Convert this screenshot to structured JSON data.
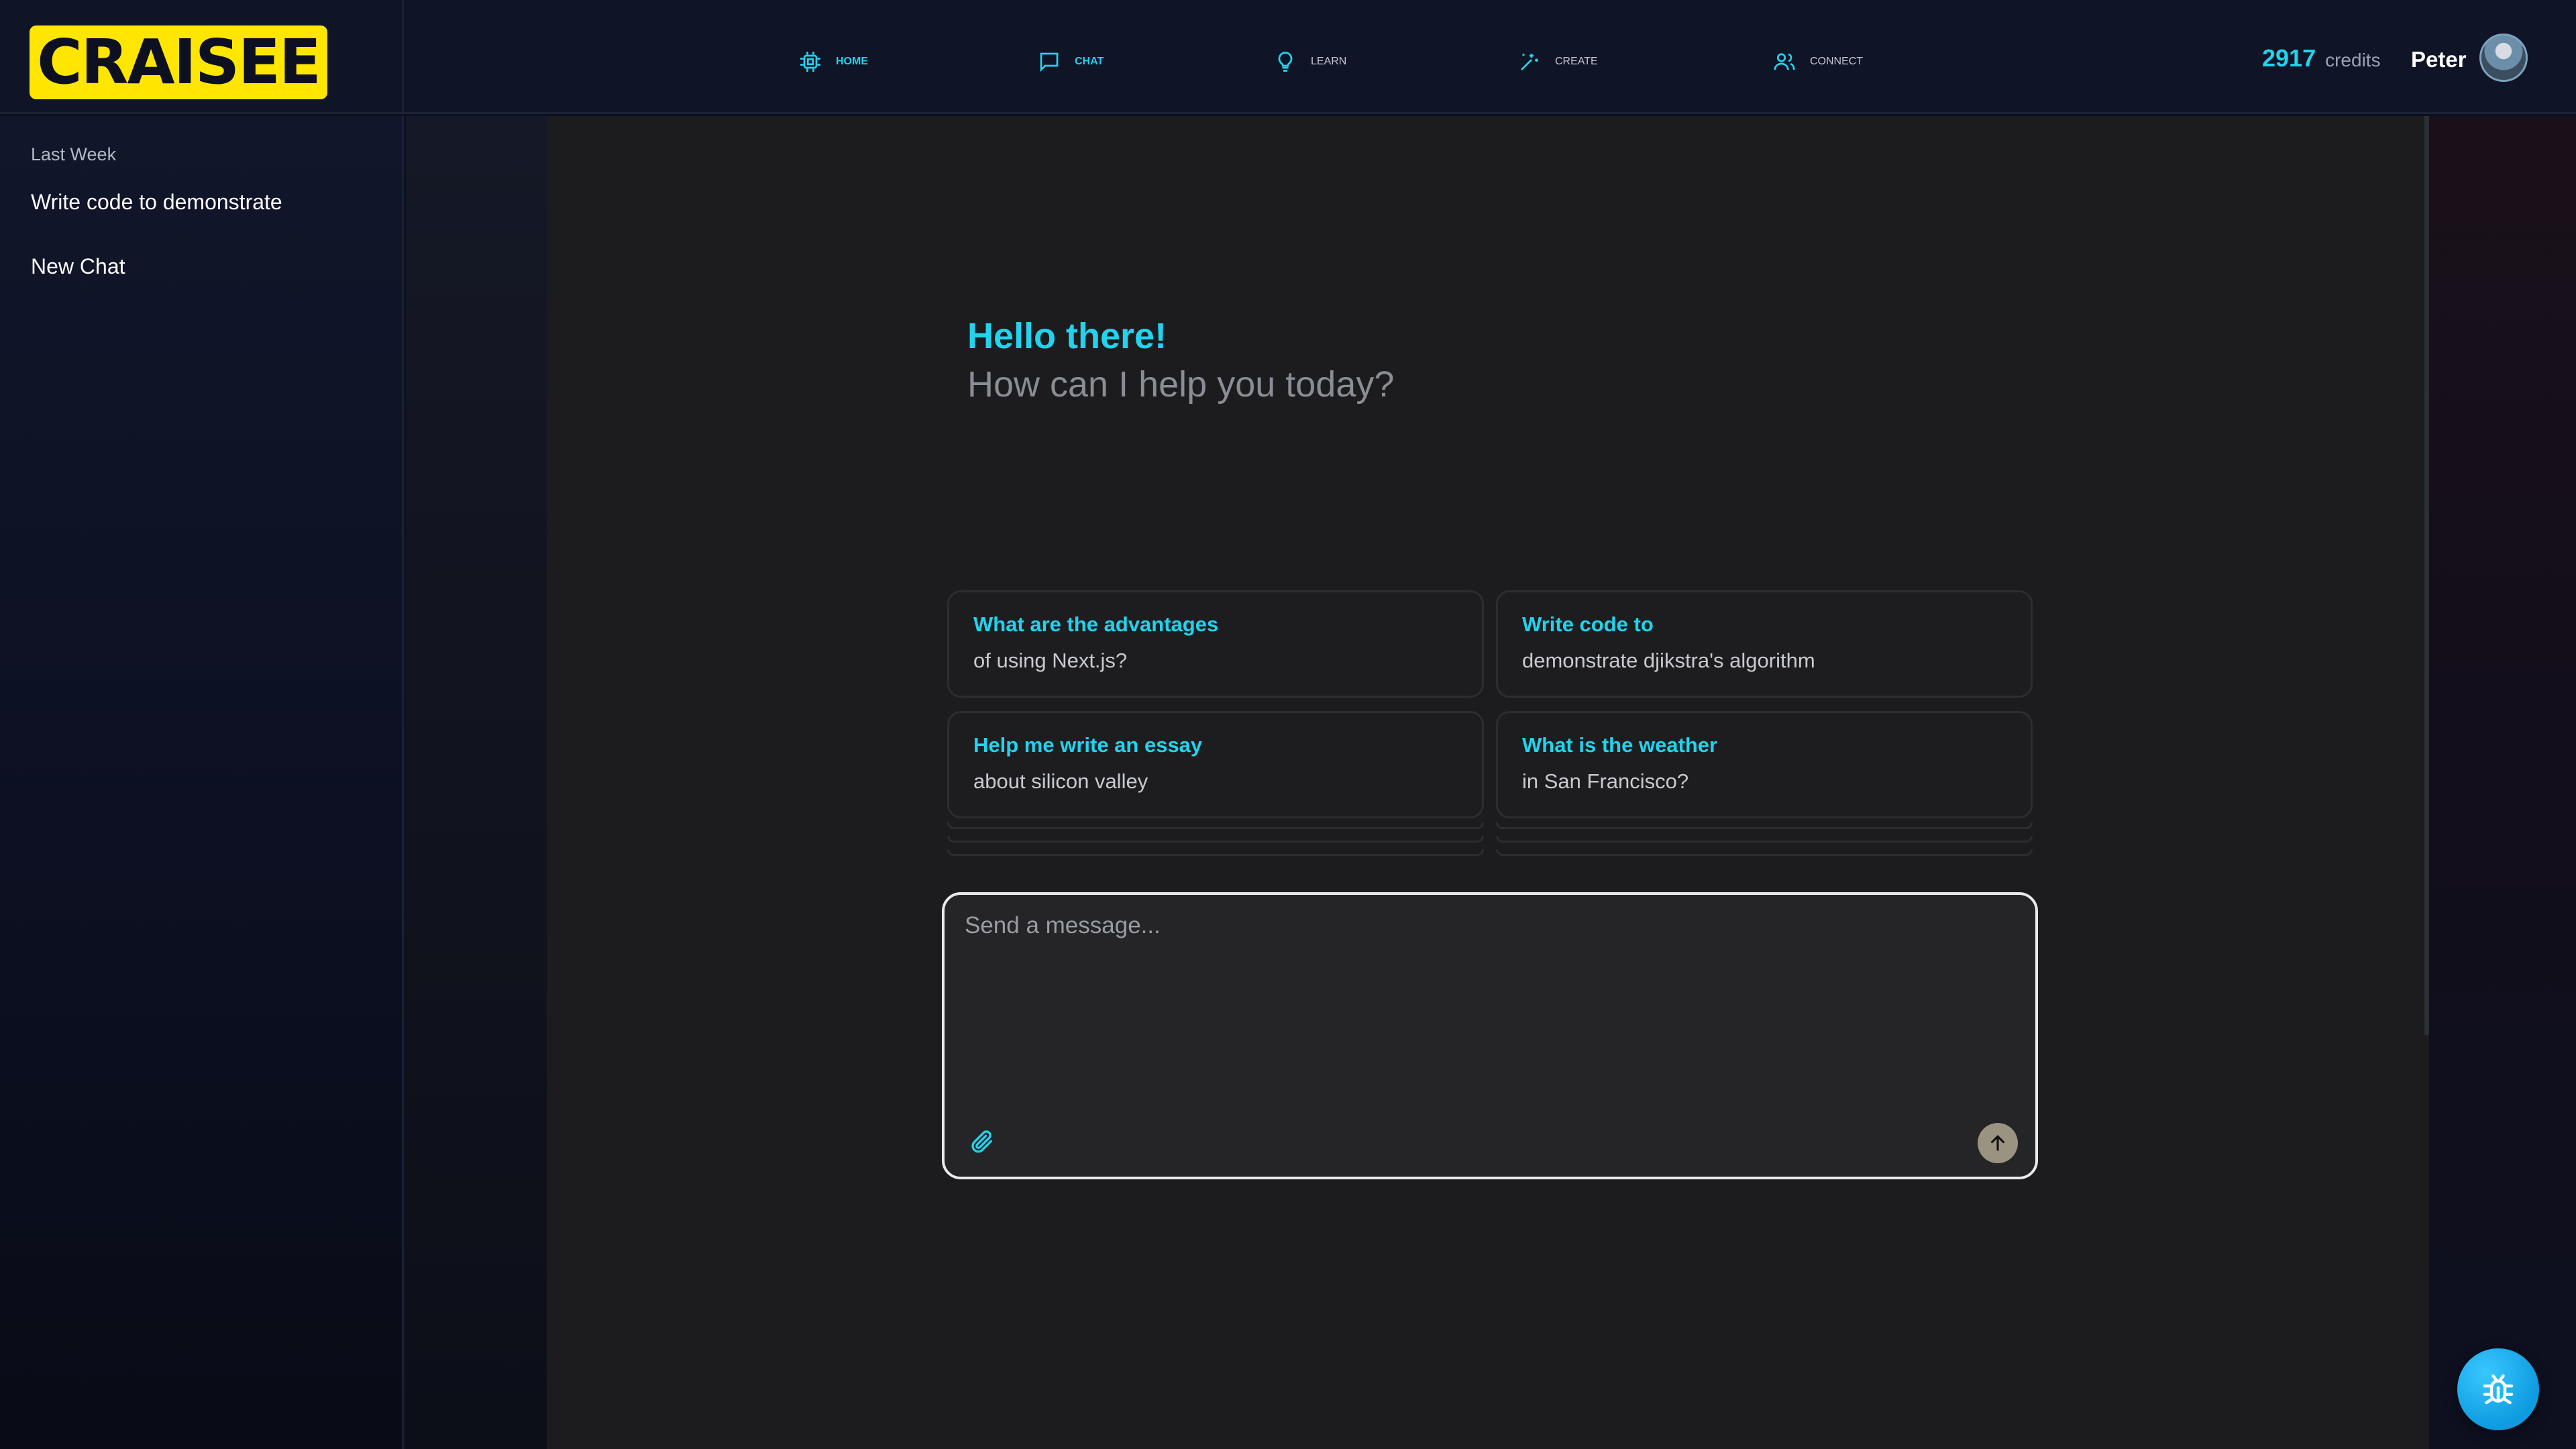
{
  "brand": {
    "logo_text": "CRAISEE",
    "logo_color": "#ffe600"
  },
  "nav": {
    "items": [
      {
        "label": "HOME",
        "icon": "cpu-icon",
        "active": true
      },
      {
        "label": "CHAT",
        "icon": "chat-bubble-icon",
        "active": false
      },
      {
        "label": "LEARN",
        "icon": "lightbulb-icon",
        "active": false
      },
      {
        "label": "CREATE",
        "icon": "sparkle-wand-icon",
        "active": false
      },
      {
        "label": "CONNECT",
        "icon": "users-icon",
        "active": false
      }
    ]
  },
  "account": {
    "credits_value": "2917",
    "credits_label": "credits",
    "user_name": "Peter"
  },
  "sidebar": {
    "section_label": "Last Week",
    "items": [
      {
        "label": "Write code to demonstrate"
      },
      {
        "label": "New Chat"
      }
    ]
  },
  "greeting": {
    "title": "Hello there!",
    "subtitle": "How can I help you today?"
  },
  "suggestions": [
    {
      "title": "What are the advantages",
      "subtitle": "of using Next.js?"
    },
    {
      "title": "Write code to",
      "subtitle": "demonstrate djikstra's algorithm"
    },
    {
      "title": "Help me write an essay",
      "subtitle": "about silicon valley"
    },
    {
      "title": "What is the weather",
      "subtitle": "in San Francisco?"
    }
  ],
  "composer": {
    "placeholder": "Send a message...",
    "value": ""
  },
  "colors": {
    "accent": "#22d3ee",
    "background": "#1c1c1e",
    "header": "#0f1426"
  }
}
